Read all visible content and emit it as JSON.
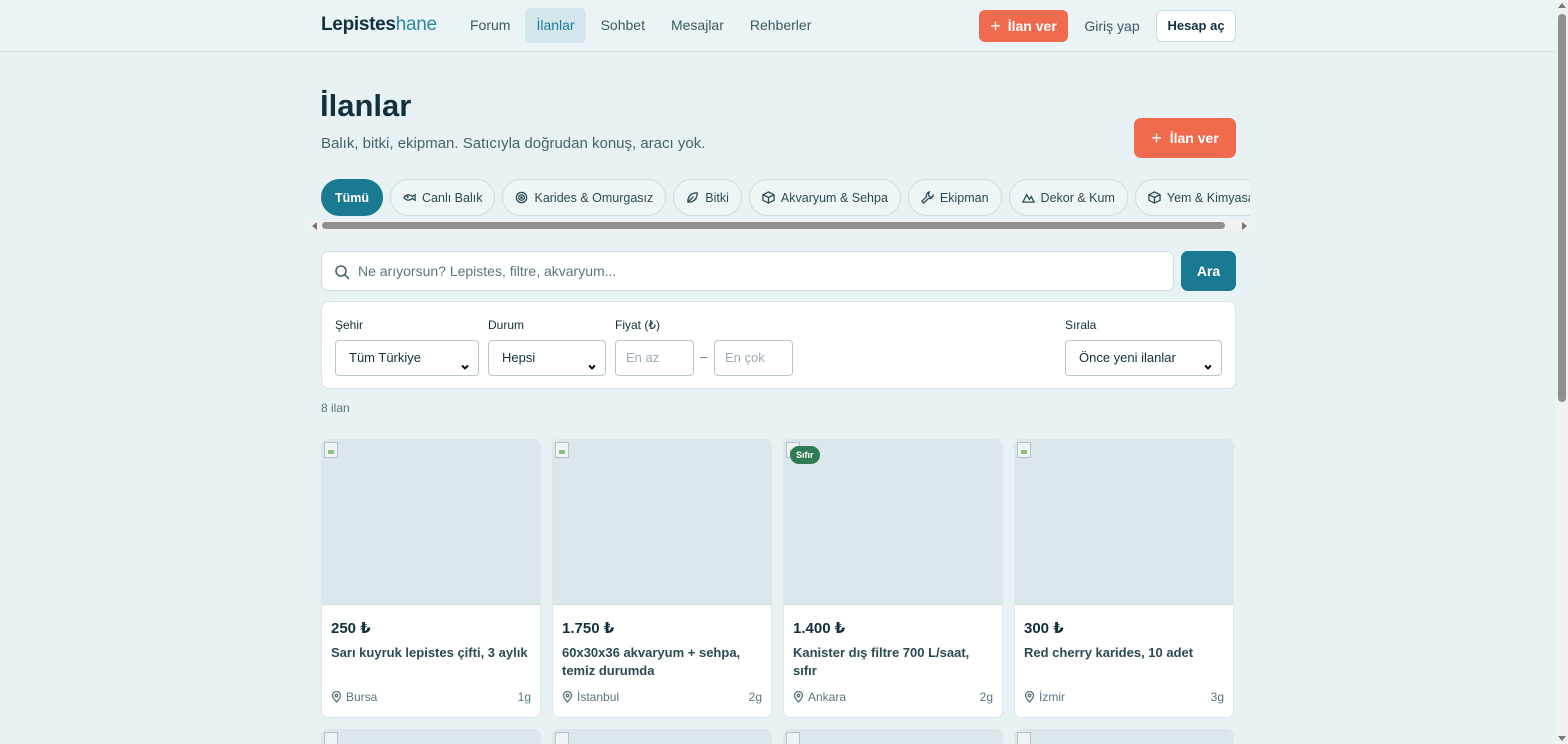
{
  "header": {
    "logo_bold": "Lepistes",
    "logo_light": "hane",
    "nav": [
      {
        "label": "Forum",
        "active": false
      },
      {
        "label": "İlanlar",
        "active": true
      },
      {
        "label": "Sohbet",
        "active": false
      },
      {
        "label": "Mesajlar",
        "active": false
      },
      {
        "label": "Rehberler",
        "active": false
      }
    ],
    "post_label": "İlan ver",
    "login_label": "Giriş yap",
    "signup_label": "Hesap aç"
  },
  "page": {
    "title": "İlanlar",
    "subtitle": "Balık, bitki, ekipman. Satıcıyla doğrudan konuş, aracı yok.",
    "post_label": "İlan ver"
  },
  "categories": [
    {
      "label": "Tümü",
      "icon": "",
      "active": true
    },
    {
      "label": "Canlı Balık",
      "icon": "fish-icon",
      "active": false
    },
    {
      "label": "Karides & Omurgasız",
      "icon": "shrimp-icon",
      "active": false
    },
    {
      "label": "Bitki",
      "icon": "leaf-icon",
      "active": false
    },
    {
      "label": "Akvaryum & Sehpa",
      "icon": "box-icon",
      "active": false
    },
    {
      "label": "Ekipman",
      "icon": "wrench-icon",
      "active": false
    },
    {
      "label": "Dekor & Kum",
      "icon": "mountain-icon",
      "active": false
    },
    {
      "label": "Yem & Kimyasal",
      "icon": "box-icon",
      "active": false
    }
  ],
  "search": {
    "placeholder": "Ne arıyorsun? Lepistes, filtre, akvaryum...",
    "button_label": "Ara"
  },
  "filters": {
    "city_label": "Şehir",
    "city_value": "Tüm Türkiye",
    "condition_label": "Durum",
    "condition_value": "Hepsi",
    "price_label": "Fiyat (₺)",
    "price_min_placeholder": "En az",
    "price_max_placeholder": "En çok",
    "price_separator": "–",
    "sort_label": "Sırala",
    "sort_value": "Önce yeni ilanlar"
  },
  "results_count": "8 ilan",
  "listings": [
    {
      "price": "250 ₺",
      "title": "Sarı kuyruk lepistes çifti, 3 aylık",
      "city": "Bursa",
      "age": "1g",
      "badge": ""
    },
    {
      "price": "1.750 ₺",
      "title": "60x30x36 akvaryum + sehpa, temiz durumda",
      "city": "İstanbul",
      "age": "2g",
      "badge": ""
    },
    {
      "price": "1.400 ₺",
      "title": "Kanister dış filtre 700 L/saat, sıfır",
      "city": "Ankara",
      "age": "2g",
      "badge": "Sıfır"
    },
    {
      "price": "300 ₺",
      "title": "Red cherry karides, 10 adet",
      "city": "İzmir",
      "age": "3g",
      "badge": ""
    }
  ],
  "colors": {
    "accent": "#1a7a92",
    "cta": "#f06a4e",
    "background": "#e8f1f4",
    "badge_new": "#2f7b54"
  }
}
